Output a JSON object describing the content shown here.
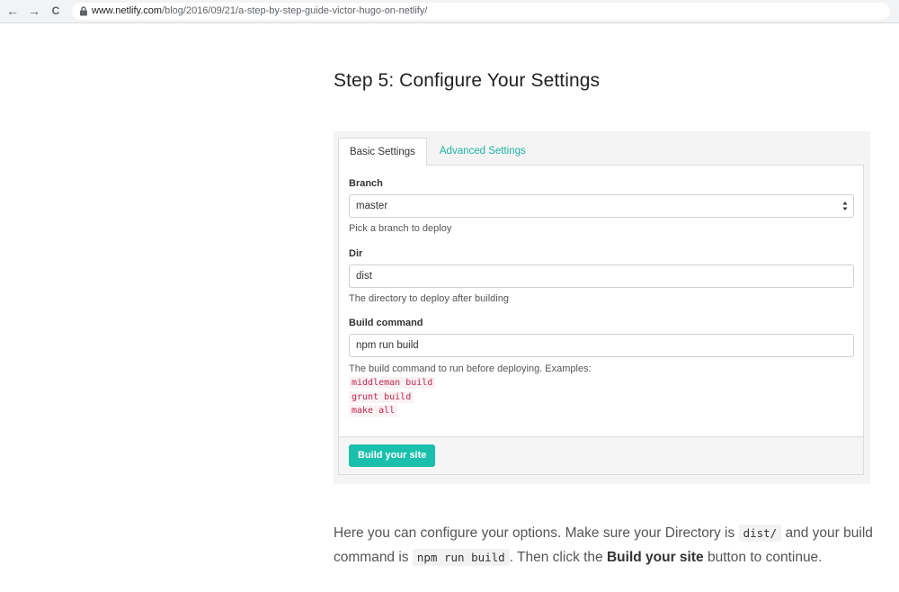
{
  "browser": {
    "back_icon": "←",
    "forward_icon": "→",
    "reload_icon": "C",
    "url_domain": "www.netlify.com",
    "url_path": "/blog/2016/09/21/a-step-by-step-guide-victor-hugo-on-netlify/"
  },
  "article": {
    "heading": "Step 5: Configure Your Settings",
    "settings": {
      "tabs": [
        "Basic Settings",
        "Advanced Settings"
      ],
      "branch": {
        "label": "Branch",
        "value": "master",
        "help": "Pick a branch to deploy"
      },
      "dir": {
        "label": "Dir",
        "value": "dist",
        "help": "The directory to deploy after building"
      },
      "build_command": {
        "label": "Build command",
        "value": "npm run build",
        "help": "The build command to run before deploying. Examples:",
        "examples": [
          "middleman build",
          "grunt build",
          "make all"
        ]
      },
      "build_button": "Build your site"
    },
    "paragraph": {
      "part1": "Here you can configure your options. Make sure your Directory is ",
      "code1": "dist/",
      "part2": " and your build command is ",
      "code2": "npm run build",
      "part3": ". Then click the ",
      "bold": "Build your site",
      "part4": " button to continue."
    }
  },
  "colors": {
    "accent": "#1bc0ad",
    "link": "#1fb4a3",
    "code_red": "#c7254e"
  }
}
